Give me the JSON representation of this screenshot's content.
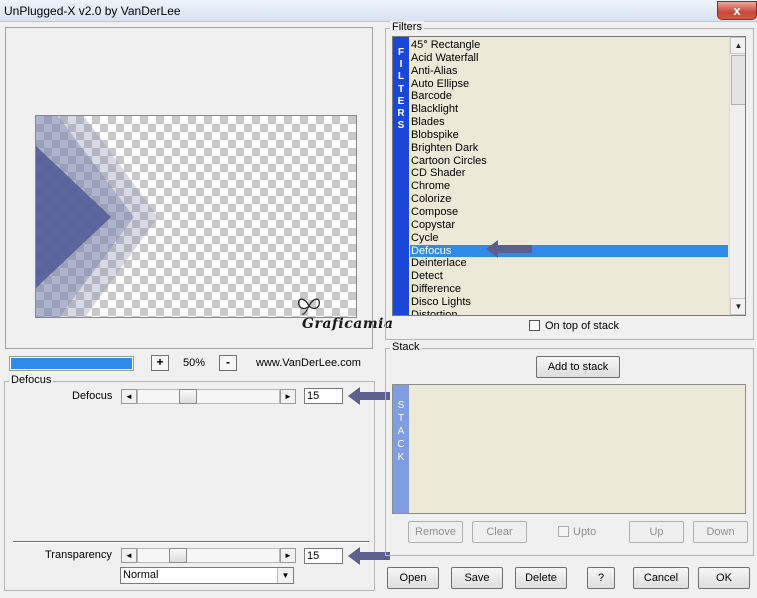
{
  "window": {
    "title": "UnPlugged-X v2.0 by VanDerLee",
    "close_label": "x"
  },
  "filters": {
    "group_label": "Filters",
    "side_letters": [
      "F",
      "I",
      "L",
      "T",
      "E",
      "R",
      "S"
    ],
    "items": [
      "45° Rectangle",
      "Acid Waterfall",
      "Anti-Alias",
      "Auto Ellipse",
      "Barcode",
      "Blacklight",
      "Blades",
      "Blobspike",
      "Brighten Dark",
      "Cartoon Circles",
      "CD Shader",
      "Chrome",
      "Colorize",
      "Compose",
      "Copystar",
      "Cycle",
      "Defocus",
      "Deinterlace",
      "Detect",
      "Difference",
      "Disco Lights",
      "Distortion"
    ],
    "selected": "Defocus",
    "on_top_label": "On top of stack",
    "scroll_up": "▲",
    "scroll_down": "▼"
  },
  "watermark": {
    "text": "Graficamia"
  },
  "zoom": {
    "plus": "+",
    "minus": "-",
    "value": "50%",
    "progress_percent": 100
  },
  "website": "www.VanDerLee.com",
  "defocus": {
    "group_label": "Defocus",
    "param_label": "Defocus",
    "value": "15",
    "slider_fraction": 0.33,
    "left_arrow": "◄",
    "right_arrow": "►"
  },
  "transparency": {
    "label": "Transparency",
    "value": "15",
    "slider_fraction": 0.25,
    "left_arrow": "◄",
    "right_arrow": "►",
    "blend_mode": "Normal",
    "dropdown_arrow": "▼"
  },
  "stack": {
    "group_label": "Stack",
    "add_label": "Add to stack",
    "side_letters": [
      "S",
      "T",
      "A",
      "C",
      "K"
    ],
    "remove_label": "Remove",
    "clear_label": "Clear",
    "upto_label": "Upto",
    "up_label": "Up",
    "down_label": "Down"
  },
  "bottom": {
    "open": "Open",
    "save": "Save",
    "delete": "Delete",
    "help": "?",
    "cancel": "Cancel",
    "ok": "OK"
  },
  "colors": {
    "selection": "#2f8bea",
    "filters_side": "#1b47d8",
    "stack_side": "#7f9de0",
    "arrow": "#5a5f8f",
    "preview_shape": "#545c9a"
  }
}
